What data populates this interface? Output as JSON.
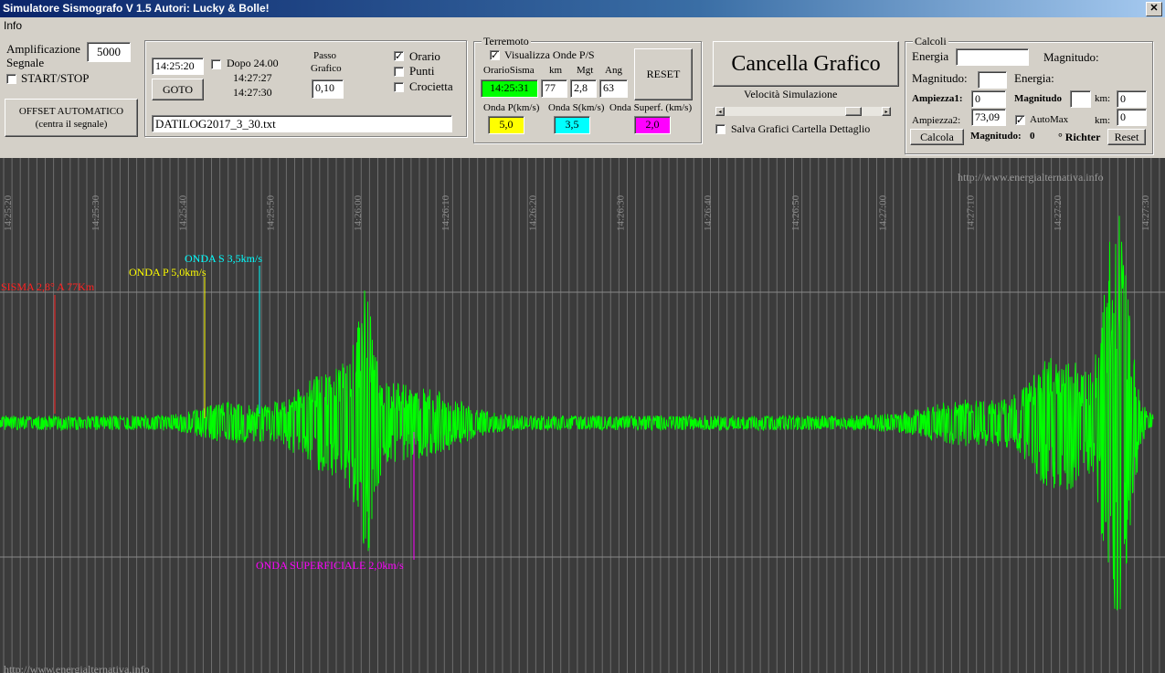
{
  "window": {
    "title": "Simulatore Sismografo V 1.5  Autori: Lucky & Bolle!",
    "close": "✕"
  },
  "menu": {
    "info": "Info"
  },
  "amp": {
    "label_line1": "Amplificazione",
    "label_line2": "Segnale",
    "value": "5000",
    "start_stop": "START/STOP",
    "offset_line1": "OFFSET AUTOMATICO",
    "offset_line2": "(centra il segnale)"
  },
  "time": {
    "start_time": "14:25:20",
    "goto": "GOTO",
    "dopo": "Dopo 24.00",
    "time_a": "14:27:27",
    "time_b": "14:27:30",
    "passo_line1": "Passo",
    "passo_line2": "Grafico",
    "passo_value": "0,10",
    "orario": "Orario",
    "orario_checked": true,
    "punti": "Punti",
    "punti_checked": false,
    "crocietta": "Crocietta",
    "crocietta_checked": false,
    "file": "DATILOG2017_3_30.txt"
  },
  "terremoto": {
    "legend": "Terremoto",
    "visualizza": "Visualizza Onde P/S",
    "visualizza_checked": true,
    "col_orario": "OrarioSisma",
    "col_km": "km",
    "col_mgt": "Mgt",
    "col_ang": "Ang",
    "orario": "14:25:31",
    "km": "77",
    "mgt": "2,8",
    "ang": "63",
    "reset": "RESET",
    "onda_p_label": "Onda P(km/s)",
    "onda_s_label": "Onda S(km/s)",
    "onda_sup_label": "Onda Superf. (km/s)",
    "onda_p": "5,0",
    "onda_s": "3,5",
    "onda_sup": "2,0",
    "color_sisma": "#00ff00",
    "color_p": "#ffff00",
    "color_s": "#00ffff",
    "color_sup": "#ff00ff"
  },
  "cancella": {
    "button": "Cancella Grafico",
    "velocita": "Velocità Simulazione",
    "slider_value": 0.86,
    "salva": "Salva Grafici Cartella Dettaglio",
    "salva_checked": false
  },
  "calcoli": {
    "legend": "Calcoli",
    "energia": "Energia",
    "energia_value": "",
    "magnitudo_top": "Magnitudo:",
    "magnitudo2": "Magnitudo:",
    "magnitudo2_value": "",
    "energia2": "Energia:",
    "ampiezza1": "Ampiezza1:",
    "ampiezza1_value": "0",
    "magnitudo_bold": "Magnitudo",
    "magnitudo_bold_value": "",
    "km1": "km:",
    "km1_value": "0",
    "ampiezza2": "Ampiezza2:",
    "ampiezza2_value": "73,09",
    "automax": "AutoMax",
    "automax_checked": true,
    "km2": "km:",
    "km2_value": "0",
    "calcola": "Calcola",
    "magnitudo_result_label": "Magnitudo:",
    "magnitudo_result": "0",
    "richter": "° Richter",
    "reset": "Reset"
  },
  "graph": {
    "watermark_top": "http://www.energialternativa.info",
    "watermark_bottom": "http://www.energialternativa.info",
    "label_sisma": "SISMA 2,8° A 77Km",
    "label_p": "ONDA P 5,0km/s",
    "label_s": "ONDA S 3,5km/s",
    "label_sup": "ONDA SUPERFICIALE 2,0km/s",
    "background": "#3b3b3b",
    "signal_color": "#00ff00",
    "sisma_color": "#ff2020",
    "tick_labels": [
      "14:25:20",
      "14:25:30",
      "14:25:40",
      "14:25:50",
      "14:26:00",
      "14:26:10",
      "14:26:20",
      "14:26:30",
      "14:26:40",
      "14:26:50",
      "14:27:00",
      "14:27:10",
      "14:27:20",
      "14:27:30"
    ]
  }
}
